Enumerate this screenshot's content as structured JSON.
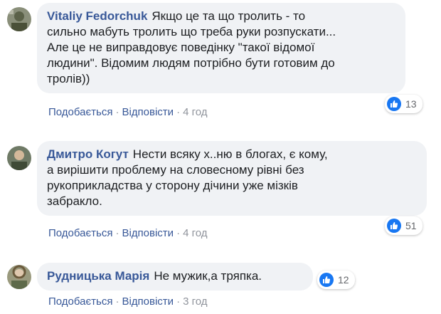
{
  "comments": [
    {
      "author": "Vitaliy Fedorchuk",
      "text": "Якщо це та що тролить - то\nсильно мабуть тролить що треба руки розпускати...\nАле це не виправдовує поведінку \"такої відомої\nлюдини\". Відомим людям потрібно бути готовим до\nтролів))",
      "reaction_count": "13",
      "like_label": "Подобається",
      "reply_label": "Відповісти",
      "time": "4 год"
    },
    {
      "author": "Дмитро Когут",
      "text": "Нести всяку х..ню в блогах, є кому,\nа вирішити проблему на словесному рівні без\nрукоприкладства у сторону дічини уже мізків\nзабракло.",
      "reaction_count": "51",
      "like_label": "Подобається",
      "reply_label": "Відповісти",
      "time": "4 год"
    },
    {
      "author": "Рудницька Марія",
      "text": "Не мужик,а тряпка.",
      "reaction_count": "12",
      "like_label": "Подобається",
      "reply_label": "Відповісти",
      "time": "3 год"
    }
  ],
  "separator": "·",
  "colors": {
    "author": "#385898",
    "bubble": "#f0f2f5",
    "like": "#1877f2"
  },
  "icons": {
    "reaction": "thumbs-up-icon",
    "avatar": "avatar"
  }
}
